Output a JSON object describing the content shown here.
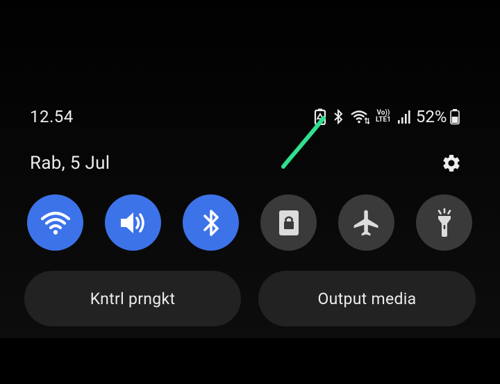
{
  "status_bar": {
    "time": "12.54",
    "battery_percent": "52%",
    "icons": [
      "battery-saver-icon",
      "bluetooth-icon",
      "wifi-icon",
      "volte-lte-icon",
      "signal-icon",
      "battery-icon"
    ],
    "volte_line1": "Vo))",
    "volte_line2": "LTE1"
  },
  "header": {
    "date": "Rab, 5 Jul",
    "settings_icon": "gear-icon"
  },
  "quick_tiles": [
    {
      "name": "wifi",
      "icon": "wifi-icon",
      "state": "on"
    },
    {
      "name": "sound",
      "icon": "speaker-icon",
      "state": "on"
    },
    {
      "name": "bluetooth",
      "icon": "bluetooth-icon",
      "state": "on"
    },
    {
      "name": "lock",
      "icon": "lock-icon",
      "state": "off"
    },
    {
      "name": "airplane",
      "icon": "airplane-icon",
      "state": "off"
    },
    {
      "name": "flashlight",
      "icon": "flashlight-icon",
      "state": "off"
    }
  ],
  "buttons": {
    "device_control": "Kntrl prngkt",
    "media_output": "Output media"
  },
  "colors": {
    "tile_on": "#3d73e9",
    "tile_off": "#3a3a3a",
    "pill_bg": "#222222",
    "annotation_stroke": "#2fe08f"
  }
}
